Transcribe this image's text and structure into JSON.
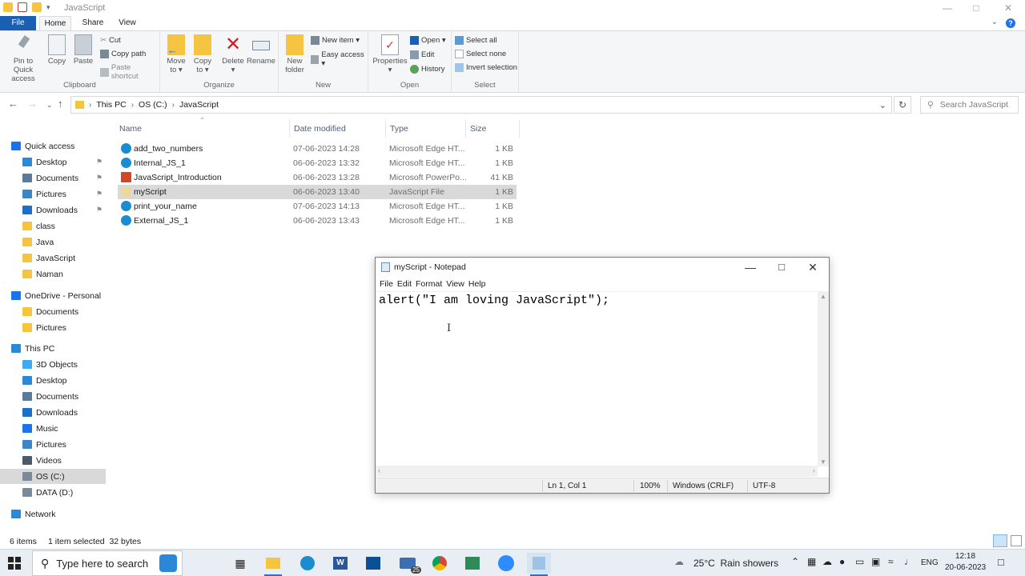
{
  "explorer": {
    "title": "JavaScript",
    "tabs": {
      "file": "File",
      "home": "Home",
      "share": "Share",
      "view": "View"
    },
    "ribbon": {
      "clipboard": {
        "label": "Clipboard",
        "pin": [
          "Pin to Quick",
          "access"
        ],
        "copy": "Copy",
        "paste": "Paste",
        "cut": "Cut",
        "copy_path": "Copy path",
        "paste_shortcut": "Paste shortcut"
      },
      "organize": {
        "label": "Organize",
        "move_to": [
          "Move",
          "to ▾"
        ],
        "copy_to": [
          "Copy",
          "to ▾"
        ],
        "delete": [
          "Delete",
          "▾"
        ],
        "rename": "Rename"
      },
      "new": {
        "label": "New",
        "new_folder": [
          "New",
          "folder"
        ],
        "new_item": "New item ▾",
        "easy_access": "Easy access ▾"
      },
      "open": {
        "label": "Open",
        "properties": [
          "Properties",
          "▾"
        ],
        "open": "Open ▾",
        "edit": "Edit",
        "history": "History"
      },
      "select": {
        "label": "Select",
        "select_all": "Select all",
        "select_none": "Select none",
        "invert_selection": "Invert selection"
      }
    },
    "address": {
      "crumbs": [
        "This PC",
        "OS (C:)",
        "JavaScript"
      ]
    },
    "search_placeholder": "Search JavaScript",
    "sidebar": [
      {
        "label": "Quick access",
        "icon": "star-icon",
        "color": "#1a73e8",
        "indent": 0,
        "pinned": false
      },
      {
        "label": "Desktop",
        "icon": "desktop-icon",
        "color": "#2b8ad8",
        "indent": 1,
        "pinned": true
      },
      {
        "label": "Documents",
        "icon": "documents-icon",
        "color": "#5c7a99",
        "indent": 1,
        "pinned": true
      },
      {
        "label": "Pictures",
        "icon": "pictures-icon",
        "color": "#3a86c8",
        "indent": 1,
        "pinned": true
      },
      {
        "label": "Downloads",
        "icon": "downloads-icon",
        "color": "#1a6fc9",
        "indent": 1,
        "pinned": true
      },
      {
        "label": "class",
        "icon": "folder-icon",
        "color": "#f5c542",
        "indent": 1,
        "pinned": false
      },
      {
        "label": "Java",
        "icon": "folder-icon",
        "color": "#f5c542",
        "indent": 1,
        "pinned": false
      },
      {
        "label": "JavaScript",
        "icon": "folder-icon",
        "color": "#f5c542",
        "indent": 1,
        "pinned": false
      },
      {
        "label": "Naman",
        "icon": "folder-icon",
        "color": "#f5c542",
        "indent": 1,
        "pinned": false
      },
      {
        "label": "OneDrive - Personal",
        "icon": "onedrive-icon",
        "color": "#1a73e8",
        "indent": 0,
        "pinned": false
      },
      {
        "label": "Documents",
        "icon": "folder-icon",
        "color": "#f5c542",
        "indent": 1,
        "pinned": false
      },
      {
        "label": "Pictures",
        "icon": "folder-icon",
        "color": "#f5c542",
        "indent": 1,
        "pinned": false
      },
      {
        "label": "This PC",
        "icon": "pc-icon",
        "color": "#2b8ad8",
        "indent": 0,
        "pinned": false
      },
      {
        "label": "3D Objects",
        "icon": "3d-objects-icon",
        "color": "#3fa9f5",
        "indent": 1,
        "pinned": false
      },
      {
        "label": "Desktop",
        "icon": "desktop-icon",
        "color": "#2b8ad8",
        "indent": 1,
        "pinned": false
      },
      {
        "label": "Documents",
        "icon": "documents-icon",
        "color": "#5c7a99",
        "indent": 1,
        "pinned": false
      },
      {
        "label": "Downloads",
        "icon": "downloads-icon",
        "color": "#1a6fc9",
        "indent": 1,
        "pinned": false
      },
      {
        "label": "Music",
        "icon": "music-icon",
        "color": "#1a73e8",
        "indent": 1,
        "pinned": false
      },
      {
        "label": "Pictures",
        "icon": "pictures-icon",
        "color": "#3a86c8",
        "indent": 1,
        "pinned": false
      },
      {
        "label": "Videos",
        "icon": "videos-icon",
        "color": "#4a5a6a",
        "indent": 1,
        "pinned": false
      },
      {
        "label": "OS (C:)",
        "icon": "drive-icon",
        "color": "#7a8a99",
        "indent": 1,
        "pinned": false,
        "selected": true
      },
      {
        "label": "DATA (D:)",
        "icon": "drive-icon",
        "color": "#7a8a99",
        "indent": 1,
        "pinned": false
      },
      {
        "label": "Network",
        "icon": "network-icon",
        "color": "#2b8ad8",
        "indent": 0,
        "pinned": false
      }
    ],
    "columns": {
      "name": "Name",
      "date": "Date modified",
      "type": "Type",
      "size": "Size"
    },
    "files": [
      {
        "name": "add_two_numbers",
        "date": "07-06-2023 14:28",
        "type": "Microsoft Edge HT...",
        "size": "1 KB",
        "icon": "edge-icon",
        "selected": false
      },
      {
        "name": "Internal_JS_1",
        "date": "06-06-2023 13:32",
        "type": "Microsoft Edge HT...",
        "size": "1 KB",
        "icon": "edge-icon",
        "selected": false
      },
      {
        "name": "JavaScript_Introduction",
        "date": "06-06-2023 13:28",
        "type": "Microsoft PowerPo...",
        "size": "41 KB",
        "icon": "powerpoint-icon",
        "selected": false
      },
      {
        "name": "myScript",
        "date": "06-06-2023 13:40",
        "type": "JavaScript File",
        "size": "1 KB",
        "icon": "script-file-icon",
        "selected": true
      },
      {
        "name": "print_your_name",
        "date": "07-06-2023 14:13",
        "type": "Microsoft Edge HT...",
        "size": "1 KB",
        "icon": "edge-icon",
        "selected": false
      },
      {
        "name": "External_JS_1",
        "date": "06-06-2023 13:43",
        "type": "Microsoft Edge HT...",
        "size": "1 KB",
        "icon": "edge-icon",
        "selected": false
      }
    ],
    "status": {
      "items": "6 items",
      "selected": "1 item selected  32 bytes"
    }
  },
  "notepad": {
    "title": "myScript - Notepad",
    "menu": [
      "File",
      "Edit",
      "Format",
      "View",
      "Help"
    ],
    "content": "alert(\"I am loving JavaScript\");",
    "status": {
      "position": "Ln 1, Col 1",
      "zoom": "100%",
      "line_endings": "Windows (CRLF)",
      "encoding": "UTF-8"
    }
  },
  "taskbar": {
    "search_placeholder": "Type here to search",
    "mail_badge": "25",
    "weather": "25°C  Rain showers",
    "language": "ENG",
    "time": "12:18",
    "date": "20-06-2023"
  }
}
